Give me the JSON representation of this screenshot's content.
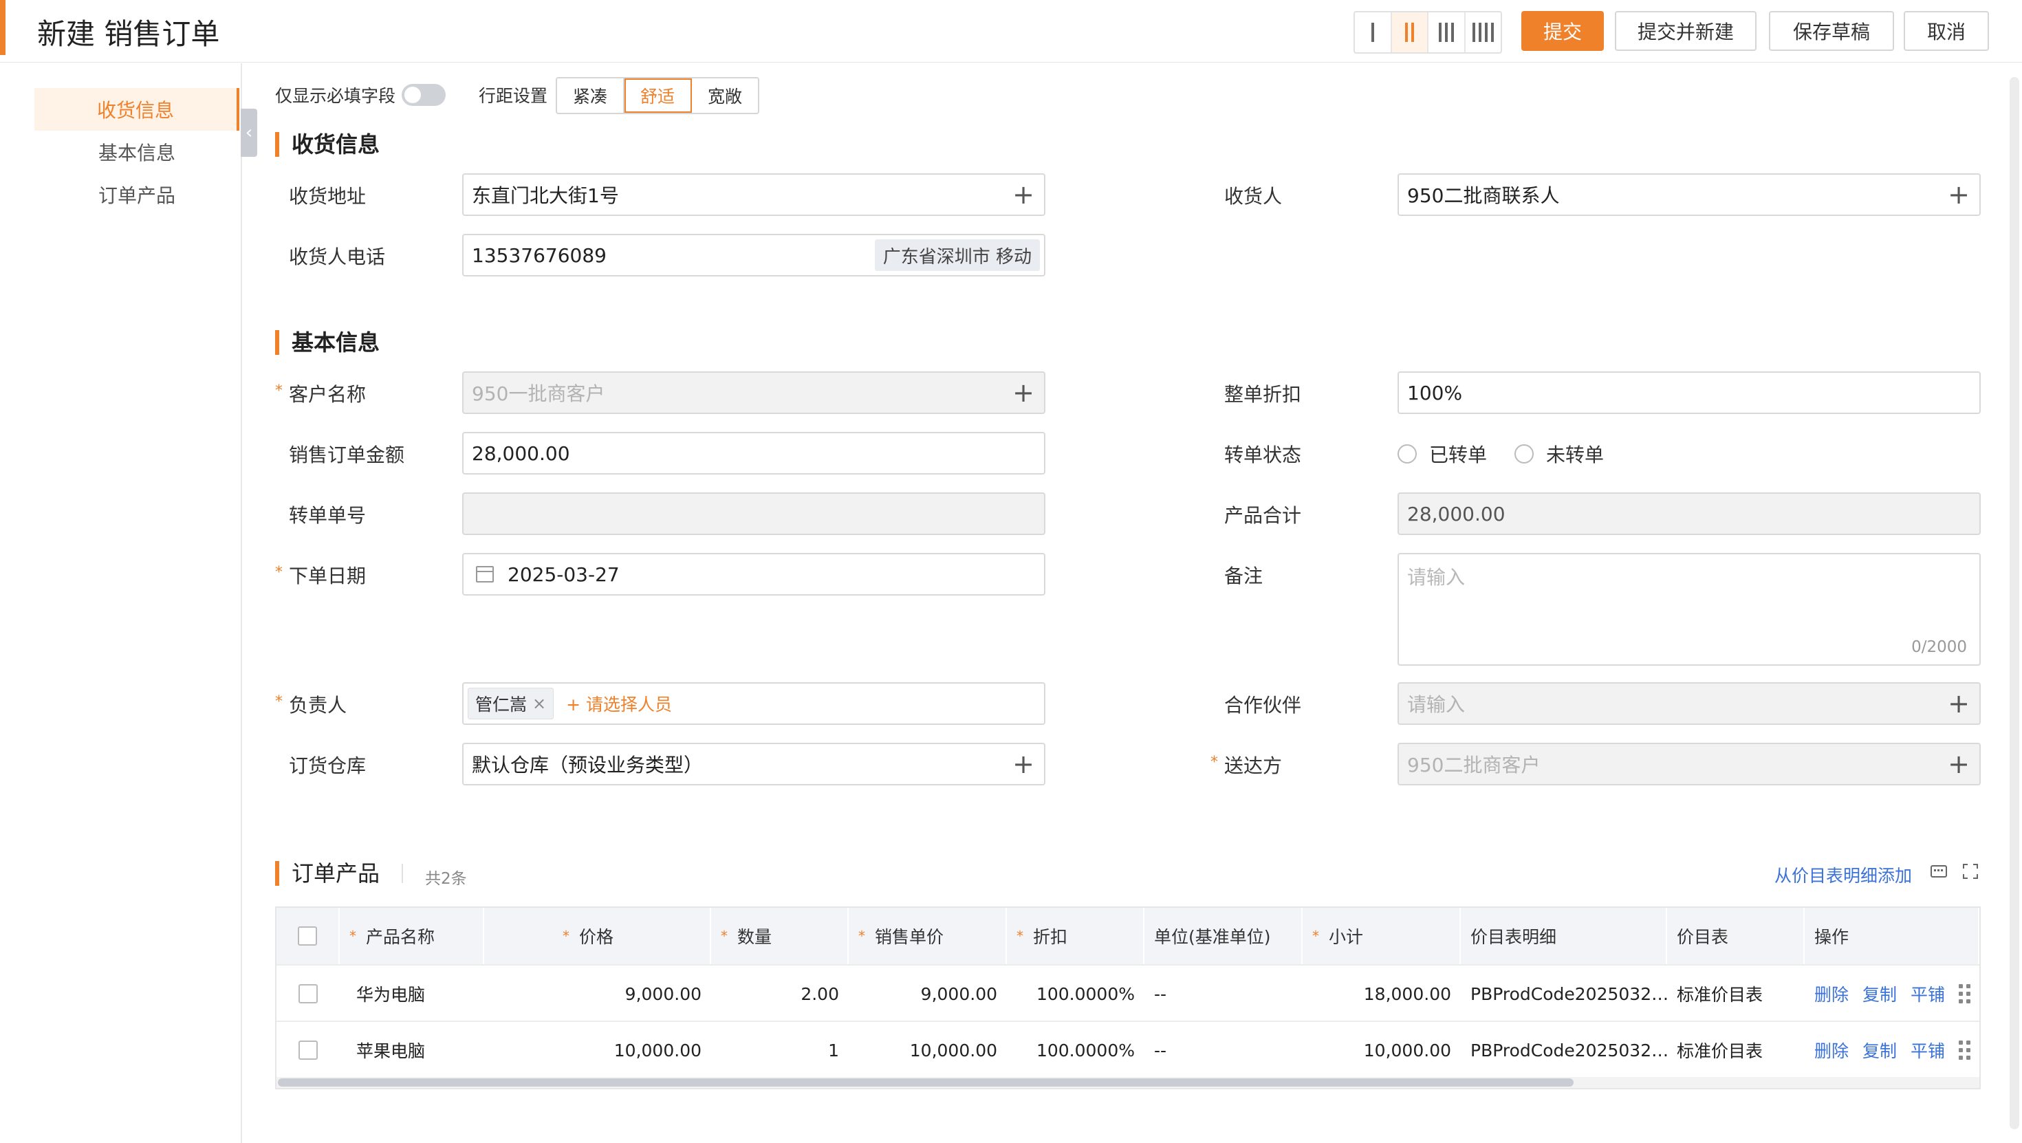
{
  "header": {
    "title": "新建 销售订单",
    "buttons": {
      "submit": "提交",
      "submit_new": "提交并新建",
      "save_draft": "保存草稿",
      "cancel": "取消"
    }
  },
  "sidebar": {
    "items": [
      {
        "label": "收货信息"
      },
      {
        "label": "基本信息"
      },
      {
        "label": "订单产品"
      }
    ]
  },
  "toolbar": {
    "required_only_label": "仅显示必填字段",
    "row_spacing_label": "行距设置",
    "spacing_options": [
      "紧凑",
      "舒适",
      "宽敞"
    ],
    "spacing_selected": "舒适"
  },
  "shipping": {
    "section_title": "收货信息",
    "address_label": "收货地址",
    "address_value": "东直门北大街1号",
    "consignee_label": "收货人",
    "consignee_value": "950二批商联系人",
    "phone_label": "收货人电话",
    "phone_value": "13537676089",
    "phone_location": "广东省深圳市 移动"
  },
  "basic": {
    "section_title": "基本信息",
    "customer_label": "客户名称",
    "customer_value": "950一批商客户",
    "discount_label": "整单折扣",
    "discount_value": "100%",
    "amount_label": "销售订单金额",
    "amount_value": "28,000.00",
    "transfer_status_label": "转单状态",
    "transfer_status_options": [
      "已转单",
      "未转单"
    ],
    "transfer_no_label": "转单单号",
    "transfer_no_value": "",
    "product_total_label": "产品合计",
    "product_total_value": "28,000.00",
    "order_date_label": "下单日期",
    "order_date_value": "2025-03-27",
    "remark_label": "备注",
    "remark_placeholder": "请输入",
    "remark_counter": "0/2000",
    "owner_label": "负责人",
    "owner_tag": "管仁嵩",
    "owner_add": "+ 请选择人员",
    "partner_label": "合作伙伴",
    "partner_placeholder": "请输入",
    "warehouse_label": "订货仓库",
    "warehouse_value": "默认仓库（预设业务类型）",
    "ship_to_label": "送达方",
    "ship_to_value": "950二批商客户"
  },
  "products": {
    "section_title": "订单产品",
    "count_text": "共2条",
    "add_from_pricebook": "从价目表明细添加",
    "columns": [
      "产品名称",
      "价格",
      "数量",
      "销售单价",
      "折扣",
      "单位(基准单位)",
      "小计",
      "价目表明细",
      "价目表",
      "操作"
    ],
    "rows": [
      {
        "name": "华为电脑",
        "price": "9,000.00",
        "qty": "2.00",
        "unit_price": "9,000.00",
        "discount": "100.0000%",
        "unit": "--",
        "subtotal": "18,000.00",
        "pricebook_item": "PBProdCode2025032…",
        "pricebook": "标准价目表"
      },
      {
        "name": "苹果电脑",
        "price": "10,000.00",
        "qty": "1",
        "unit_price": "10,000.00",
        "discount": "100.0000%",
        "unit": "--",
        "subtotal": "10,000.00",
        "pricebook_item": "PBProdCode2025032…",
        "pricebook": "标准价目表"
      }
    ],
    "actions": {
      "delete": "删除",
      "copy": "复制",
      "tile": "平铺"
    }
  },
  "colors": {
    "accent": "#f0812b",
    "link": "#3a72d8"
  }
}
